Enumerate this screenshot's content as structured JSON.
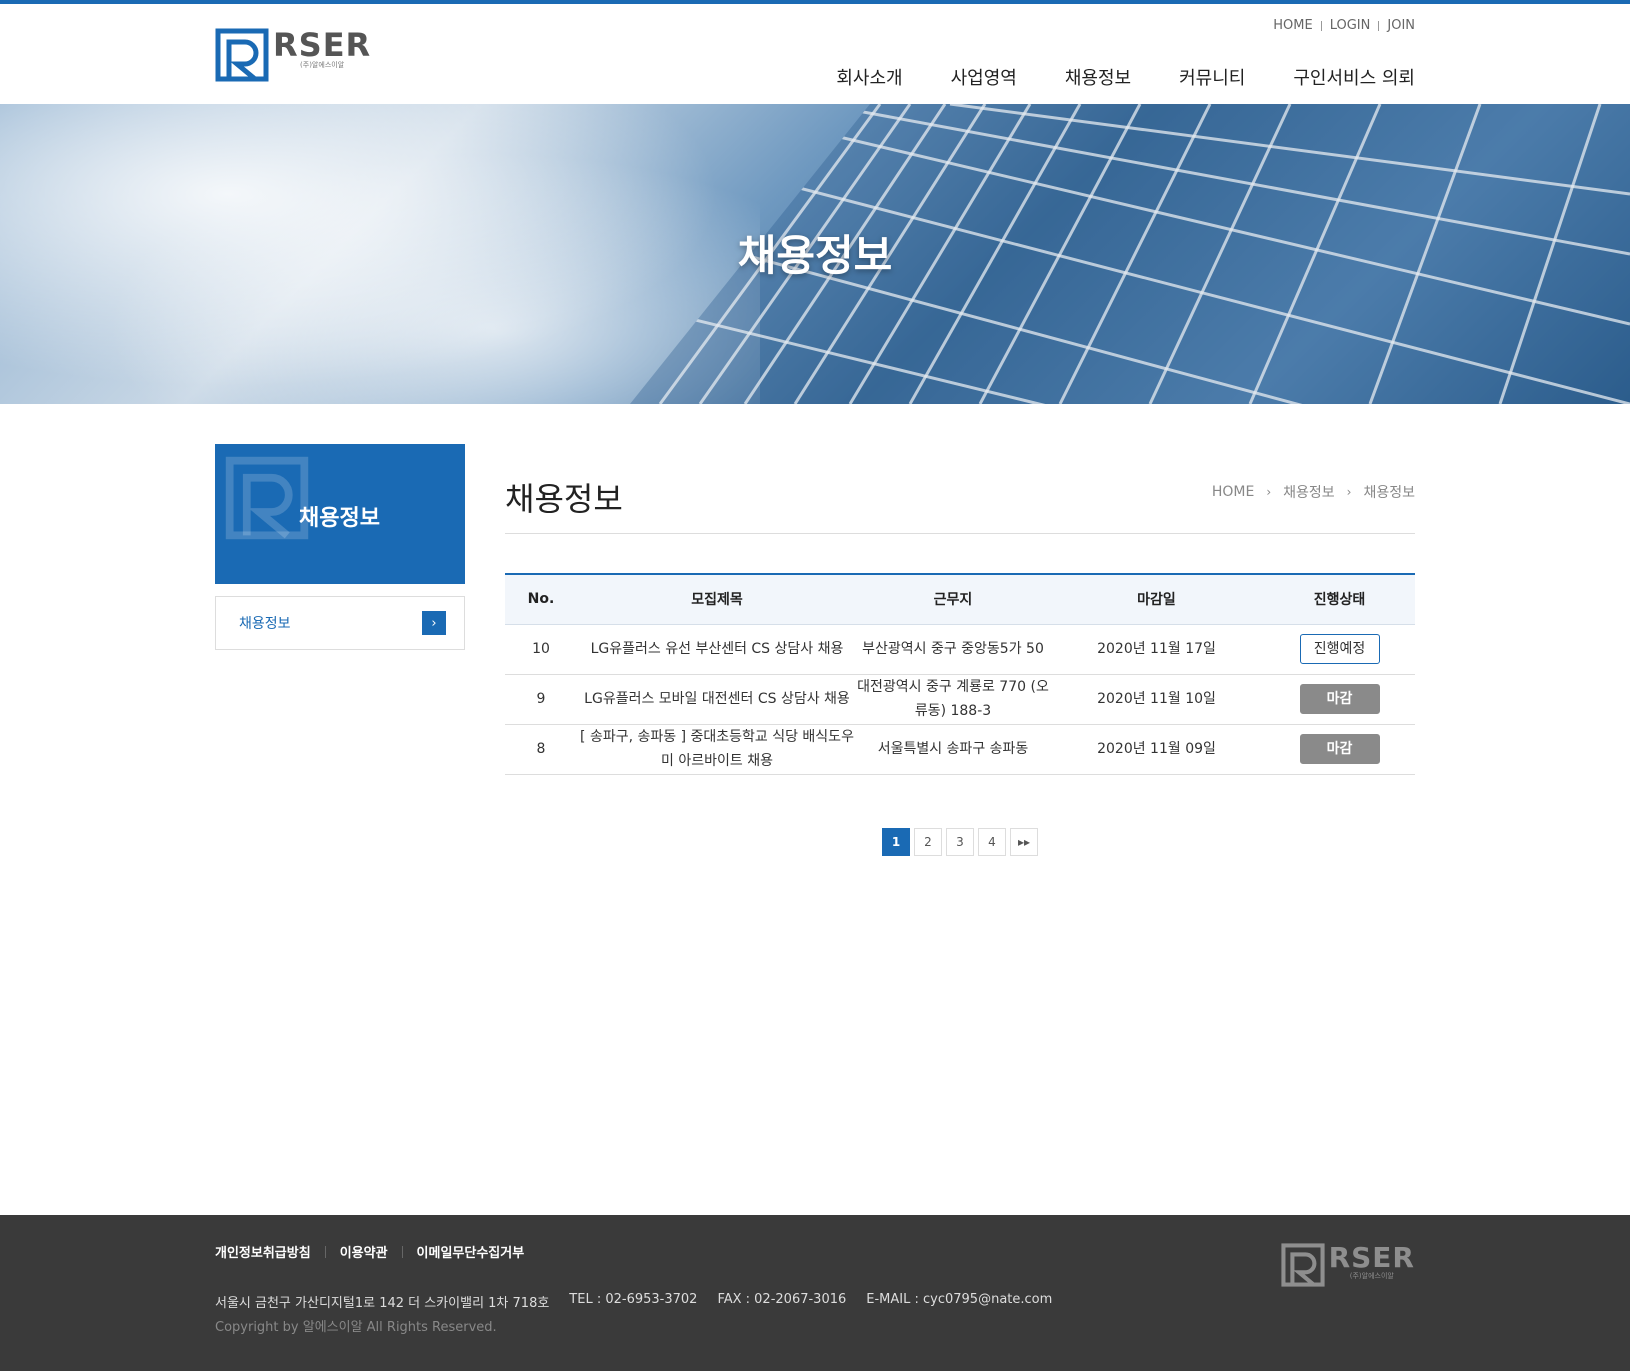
{
  "brand": {
    "wordmark": "RSER",
    "sub": "(주)알에스이알",
    "color": "#1a6ab4"
  },
  "util_links": [
    "HOME",
    "LOGIN",
    "JOIN"
  ],
  "gnb": [
    "회사소개",
    "사업영역",
    "채용정보",
    "커뮤니티",
    "구인서비스 의뢰"
  ],
  "hero": {
    "title": "채용정보"
  },
  "side": {
    "title": "채용정보",
    "items": [
      {
        "label": "채용정보",
        "icon": "chevron-right-icon"
      }
    ]
  },
  "main": {
    "title": "채용정보",
    "breadcrumb": [
      "HOME",
      "채용정보",
      "채용정보"
    ]
  },
  "table": {
    "headers": [
      "No.",
      "모집제목",
      "근무지",
      "마감일",
      "진행상태"
    ],
    "rows": [
      {
        "no": "10",
        "title": "LG유플러스 유선 부산센터 CS 상담사 채용",
        "location": "부산광역시 중구 중앙동5가 50",
        "deadline": "2020년 11월 17일",
        "status": "진행예정",
        "status_type": "open"
      },
      {
        "no": "9",
        "title": "LG유플러스 모바일 대전센터 CS 상담사 채용",
        "location": "대전광역시 중구 계룡로 770 (오류동) 188-3",
        "deadline": "2020년 11월 10일",
        "status": "마감",
        "status_type": "closed"
      },
      {
        "no": "8",
        "title": "[ 송파구, 송파동 ] 중대초등학교 식당 배식도우미 아르바이트 채용",
        "location": "서울특별시 송파구 송파동",
        "deadline": "2020년 11월 09일",
        "status": "마감",
        "status_type": "closed"
      }
    ]
  },
  "pagination": {
    "pages": [
      "1",
      "2",
      "3",
      "4"
    ],
    "current": "1",
    "next_icon": "double-chevron-right-icon"
  },
  "footer": {
    "links": [
      "개인정보취급방침",
      "이용약관",
      "이메일무단수집거부"
    ],
    "address": "서울시 금천구 가산디지털1로 142 더 스카이밸리 1차 718호",
    "tel": "TEL : 02-6953-3702",
    "fax": "FAX : 02-2067-3016",
    "email": "E-MAIL : cyc0795@nate.com",
    "copyright": "Copyright by 알에스이알 All Rights Reserved."
  }
}
